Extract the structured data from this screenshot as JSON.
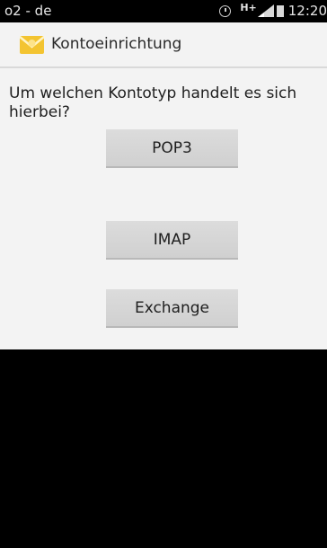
{
  "statusbar": {
    "carrier": "o2 - de",
    "network_type": "H+",
    "time": "12:20",
    "icons": [
      "alarm-icon",
      "signal-icon",
      "battery-icon"
    ]
  },
  "actionbar": {
    "title": "Kontoeinrichtung",
    "icon": "mail-envelope-icon"
  },
  "content": {
    "question": "Um welchen Kontotyp handelt es sich hierbei?",
    "buttons": {
      "pop3": "POP3",
      "imap": "IMAP",
      "exchange": "Exchange"
    }
  },
  "colors": {
    "background": "#f3f3f3",
    "button": "#d6d6d6",
    "statusbar": "#000000",
    "envelope": "#f3c431"
  }
}
